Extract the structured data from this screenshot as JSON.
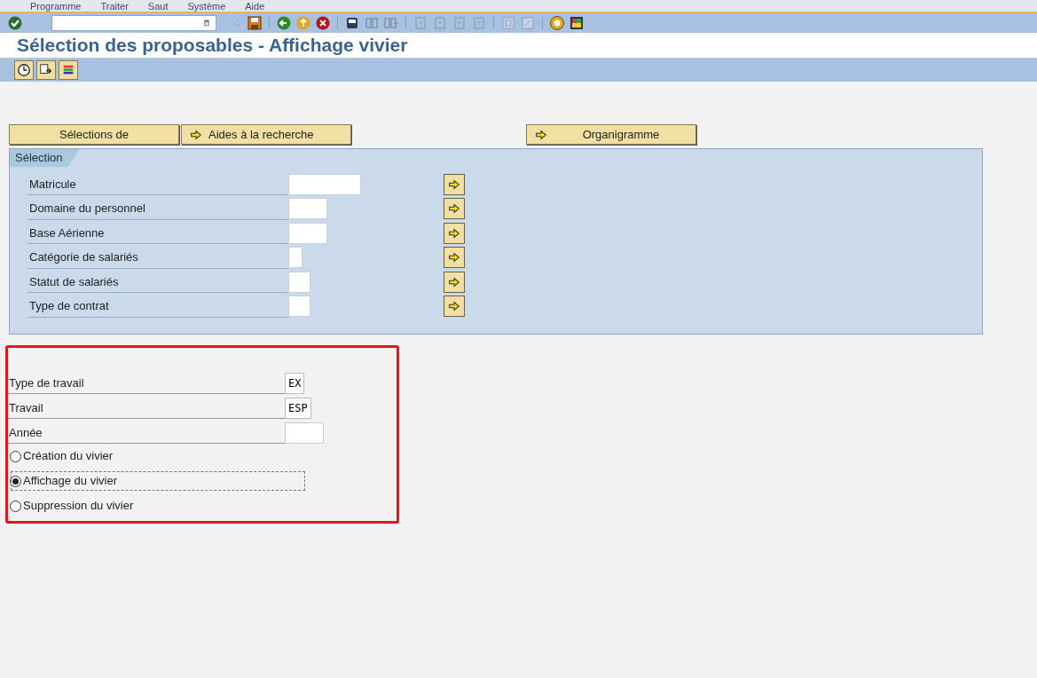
{
  "menu_bar": [
    "Programme",
    "Traiter",
    "Saut",
    "Système",
    "Aide"
  ],
  "title": "Sélection des proposables - Affichage vivier",
  "buttons": [
    {
      "label": "Sélections de",
      "arrow": false
    },
    {
      "label": "Aides à la recherche",
      "arrow": true
    },
    {
      "label": "Organigramme",
      "arrow": true
    }
  ],
  "selection": {
    "title": "Sélection",
    "fields": [
      {
        "label": "Matricule"
      },
      {
        "label": "Domaine du personnel"
      },
      {
        "label": "Base Aérienne"
      },
      {
        "label": "Catégorie de salariés"
      },
      {
        "label": "Statut de salariés"
      },
      {
        "label": "Type de contrat"
      }
    ]
  },
  "job_fields": [
    {
      "label": "Type de travail",
      "value": "EX"
    },
    {
      "label": "Travail",
      "value": "ESP"
    },
    {
      "label": "Année"
    }
  ],
  "radios": [
    {
      "label": "Création du vivier",
      "selected": false
    },
    {
      "label": "Affichage du vivier",
      "selected": true
    },
    {
      "label": "Suppression du vivier",
      "selected": false
    }
  ]
}
